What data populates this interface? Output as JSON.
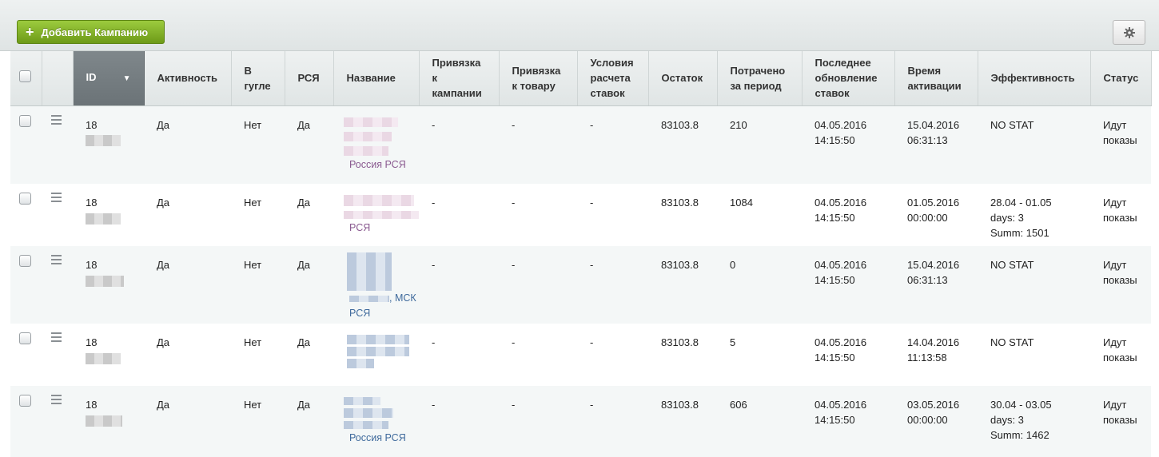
{
  "toolbar": {
    "add_label": "Добавить Кампанию",
    "add_icon": "plus-icon",
    "settings_icon": "gear-icon"
  },
  "table": {
    "headers": {
      "id": "ID",
      "activity": "Активность",
      "in_google": "В гугле",
      "rsya": "РСЯ",
      "name": "Название",
      "link_campaign": "Привязка к кампании",
      "link_product": "Привязка к товару",
      "bid_conditions": "Условия расчета ставок",
      "balance": "Остаток",
      "spent": "Потрачено за период",
      "last_update": "Последнее обновление ставок",
      "activation_time": "Время активации",
      "efficiency": "Эффективность",
      "status": "Статус"
    },
    "sort_indicator": "▼",
    "rows": [
      {
        "id": "18",
        "activity": "Да",
        "in_google": "Нет",
        "rsya": "Да",
        "name_region": "Россия РСЯ",
        "link_campaign": "-",
        "link_product": "-",
        "bid_conditions": "-",
        "balance": "83103.8",
        "spent": "210",
        "last_update_date": "04.05.2016",
        "last_update_time": "14:15:50",
        "activation_date": "15.04.2016",
        "activation_time": "06:31:13",
        "eff_line1": "NO STAT",
        "eff_line2": "",
        "eff_line3": "",
        "status_line1": "Идут",
        "status_line2": "показы"
      },
      {
        "id": "18",
        "activity": "Да",
        "in_google": "Нет",
        "rsya": "Да",
        "name_region": "РСЯ",
        "link_campaign": "-",
        "link_product": "-",
        "bid_conditions": "-",
        "balance": "83103.8",
        "spent": "1084",
        "last_update_date": "04.05.2016",
        "last_update_time": "14:15:50",
        "activation_date": "01.05.2016",
        "activation_time": "00:00:00",
        "eff_line1": "28.04 - 01.05",
        "eff_line2": "days: 3",
        "eff_line3": "Summ: 1501",
        "status_line1": "Идут",
        "status_line2": "показы"
      },
      {
        "id": "18",
        "activity": "Да",
        "in_google": "Нет",
        "rsya": "Да",
        "name_region": ", МСК",
        "name_region2": "РСЯ",
        "link_campaign": "-",
        "link_product": "-",
        "bid_conditions": "-",
        "balance": "83103.8",
        "spent": "0",
        "last_update_date": "04.05.2016",
        "last_update_time": "14:15:50",
        "activation_date": "15.04.2016",
        "activation_time": "06:31:13",
        "eff_line1": "NO STAT",
        "eff_line2": "",
        "eff_line3": "",
        "status_line1": "Идут",
        "status_line2": "показы"
      },
      {
        "id": "18",
        "activity": "Да",
        "in_google": "Нет",
        "rsya": "Да",
        "name_region": "",
        "link_campaign": "-",
        "link_product": "-",
        "bid_conditions": "-",
        "balance": "83103.8",
        "spent": "5",
        "last_update_date": "04.05.2016",
        "last_update_time": "14:15:50",
        "activation_date": "14.04.2016",
        "activation_time": "11:13:58",
        "eff_line1": "NO STAT",
        "eff_line2": "",
        "eff_line3": "",
        "status_line1": "Идут",
        "status_line2": "показы"
      },
      {
        "id": "18",
        "activity": "Да",
        "in_google": "Нет",
        "rsya": "Да",
        "name_region": "Россия РСЯ",
        "link_campaign": "-",
        "link_product": "-",
        "bid_conditions": "-",
        "balance": "83103.8",
        "spent": "606",
        "last_update_date": "04.05.2016",
        "last_update_time": "14:15:50",
        "activation_date": "03.05.2016",
        "activation_time": "00:00:00",
        "eff_line1": "30.04 - 03.05",
        "eff_line2": "days: 3",
        "eff_line3": "Summ: 1462",
        "status_line1": "Идут",
        "status_line2": "показы"
      }
    ]
  }
}
